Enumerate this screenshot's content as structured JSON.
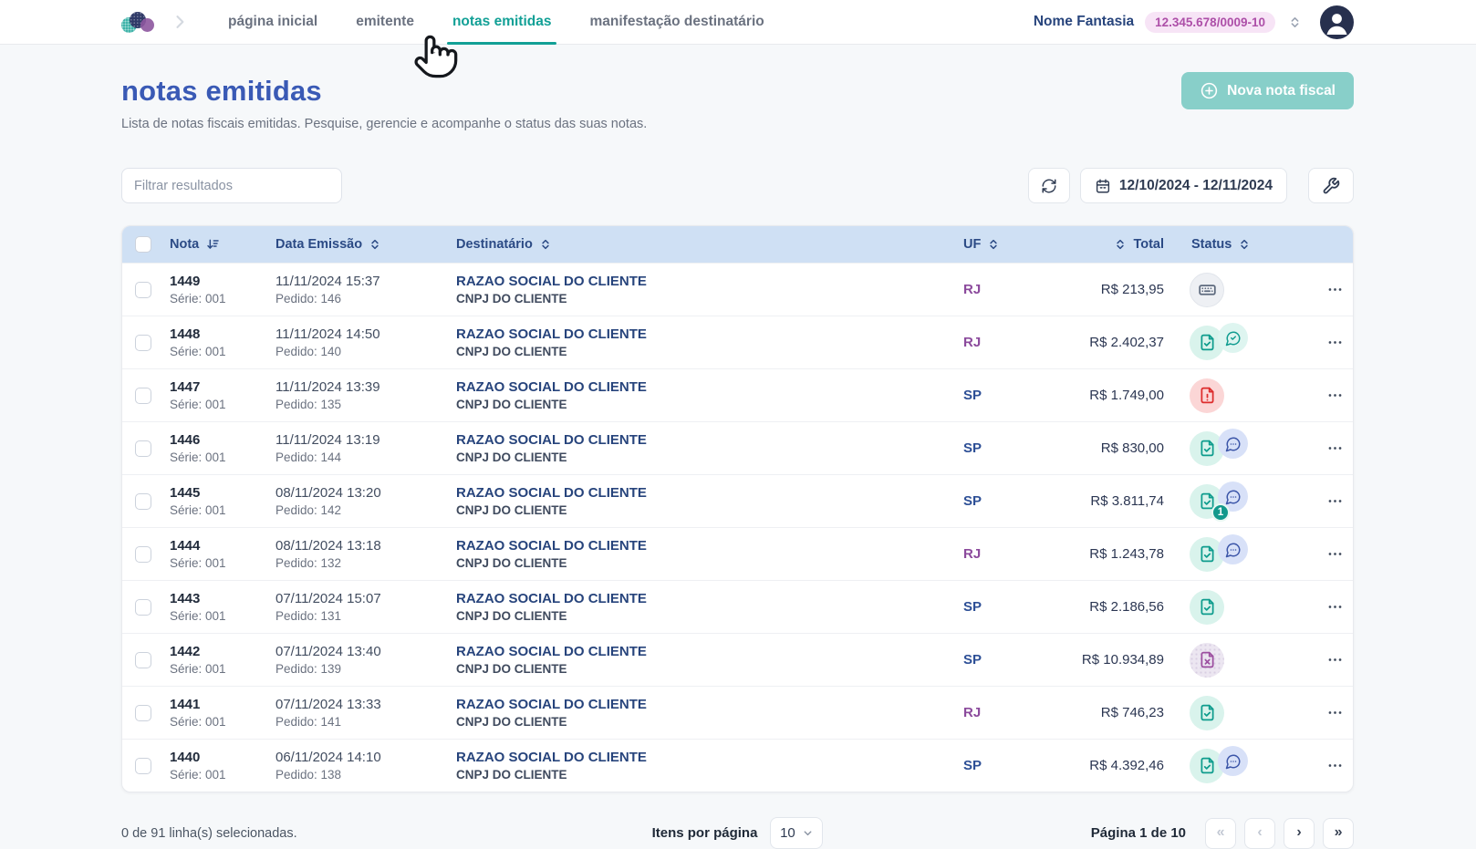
{
  "topbar": {
    "nav": [
      {
        "label": "página inicial",
        "active": false
      },
      {
        "label": "emitente",
        "active": false
      },
      {
        "label": "notas emitidas",
        "active": true
      },
      {
        "label": "manifestação destinatário",
        "active": false
      }
    ],
    "company_name": "Nome Fantasia",
    "company_cnpj": "12.345.678/0009-10"
  },
  "page": {
    "title": "notas emitidas",
    "subtitle": "Lista de notas fiscais emitidas. Pesquise, gerencie e acompanhe o status das suas notas.",
    "new_invoice_label": "Nova nota fiscal"
  },
  "filters": {
    "search_placeholder": "Filtrar resultados",
    "date_range": "12/10/2024 - 12/11/2024"
  },
  "table": {
    "columns": {
      "nota": "Nota",
      "data": "Data Emissão",
      "dest": "Destinatário",
      "uf": "UF",
      "total": "Total",
      "status": "Status"
    },
    "rows": [
      {
        "nota": "1449",
        "serie": "Série: 001",
        "emissao": "11/11/2024 15:37",
        "pedido": "Pedido: 146",
        "destinatario": "RAZAO SOCIAL DO CLIENTE",
        "cnpj": "CNPJ DO CLIENTE",
        "uf": "RJ",
        "total": "R$ 213,95",
        "status": [
          "typing"
        ]
      },
      {
        "nota": "1448",
        "serie": "Série: 001",
        "emissao": "11/11/2024 14:50",
        "pedido": "Pedido: 140",
        "destinatario": "RAZAO SOCIAL DO CLIENTE",
        "cnpj": "CNPJ DO CLIENTE",
        "uf": "RJ",
        "total": "R$ 2.402,37",
        "status": [
          "authorized",
          "message-approved"
        ]
      },
      {
        "nota": "1447",
        "serie": "Série: 001",
        "emissao": "11/11/2024 13:39",
        "pedido": "Pedido: 135",
        "destinatario": "RAZAO SOCIAL DO CLIENTE",
        "cnpj": "CNPJ DO CLIENTE",
        "uf": "SP",
        "total": "R$ 1.749,00",
        "status": [
          "rejected"
        ]
      },
      {
        "nota": "1446",
        "serie": "Série: 001",
        "emissao": "11/11/2024 13:19",
        "pedido": "Pedido: 144",
        "destinatario": "RAZAO SOCIAL DO CLIENTE",
        "cnpj": "CNPJ DO CLIENTE",
        "uf": "SP",
        "total": "R$ 830,00",
        "status": [
          "authorized",
          "message-pending"
        ]
      },
      {
        "nota": "1445",
        "serie": "Série: 001",
        "emissao": "08/11/2024 13:20",
        "pedido": "Pedido: 142",
        "destinatario": "RAZAO SOCIAL DO CLIENTE",
        "cnpj": "CNPJ DO CLIENTE",
        "uf": "SP",
        "total": "R$ 3.811,74",
        "status": [
          "authorized",
          "message-pending"
        ],
        "badge": "1"
      },
      {
        "nota": "1444",
        "serie": "Série: 001",
        "emissao": "08/11/2024 13:18",
        "pedido": "Pedido: 132",
        "destinatario": "RAZAO SOCIAL DO CLIENTE",
        "cnpj": "CNPJ DO CLIENTE",
        "uf": "RJ",
        "total": "R$ 1.243,78",
        "status": [
          "authorized",
          "message-pending"
        ]
      },
      {
        "nota": "1443",
        "serie": "Série: 001",
        "emissao": "07/11/2024 15:07",
        "pedido": "Pedido: 131",
        "destinatario": "RAZAO SOCIAL DO CLIENTE",
        "cnpj": "CNPJ DO CLIENTE",
        "uf": "SP",
        "total": "R$ 2.186,56",
        "status": [
          "authorized"
        ]
      },
      {
        "nota": "1442",
        "serie": "Série: 001",
        "emissao": "07/11/2024 13:40",
        "pedido": "Pedido: 139",
        "destinatario": "RAZAO SOCIAL DO CLIENTE",
        "cnpj": "CNPJ DO CLIENTE",
        "uf": "SP",
        "total": "R$ 10.934,89",
        "status": [
          "cancelled"
        ]
      },
      {
        "nota": "1441",
        "serie": "Série: 001",
        "emissao": "07/11/2024 13:33",
        "pedido": "Pedido: 141",
        "destinatario": "RAZAO SOCIAL DO CLIENTE",
        "cnpj": "CNPJ DO CLIENTE",
        "uf": "RJ",
        "total": "R$ 746,23",
        "status": [
          "authorized"
        ]
      },
      {
        "nota": "1440",
        "serie": "Série: 001",
        "emissao": "06/11/2024 14:10",
        "pedido": "Pedido: 138",
        "destinatario": "RAZAO SOCIAL DO CLIENTE",
        "cnpj": "CNPJ DO CLIENTE",
        "uf": "SP",
        "total": "R$ 4.392,46",
        "status": [
          "authorized",
          "message-pending"
        ]
      }
    ]
  },
  "footer": {
    "selection": "0 de 91 linha(s) selecionadas.",
    "items_per_page_label": "Itens por página",
    "items_per_page_value": "10",
    "page_info": "Página 1 de 10",
    "pagination": {
      "first": "«",
      "prev": "‹",
      "next": "›",
      "last": "»"
    }
  },
  "colors": {
    "accent_teal": "#12a096",
    "button_teal": "#88cfc9",
    "title_blue": "#3a5ab5",
    "table_header_bg": "#cfe0f4",
    "table_header_text": "#2b4a85",
    "uf_rj": "#8b4a9c",
    "uf_sp": "#2d4f96",
    "cnpj_pill_bg": "#f7e4f6",
    "cnpj_pill_text": "#ad4fa8",
    "status_authorized": "#0e9c8d",
    "status_rejected": "#dd2c2c",
    "status_message": "#3b55a8",
    "status_cancelled": "#9c4fa0",
    "status_typing": "#5e6a7e"
  }
}
